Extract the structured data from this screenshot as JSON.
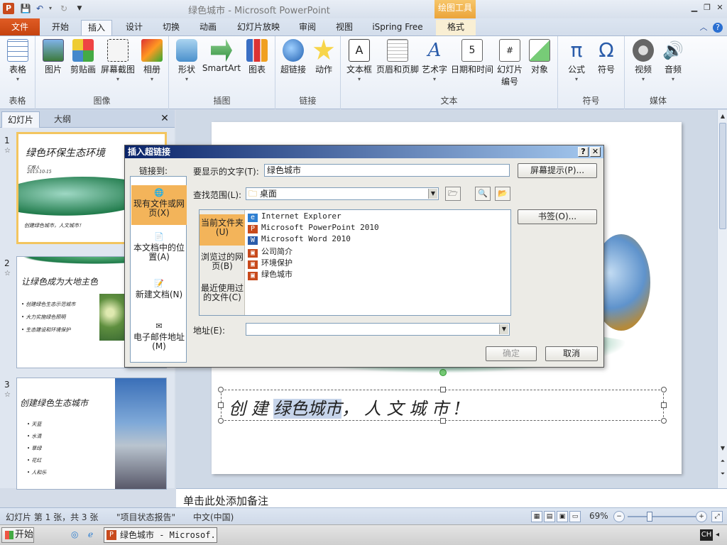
{
  "window": {
    "title": "绿色城市 - Microsoft PowerPoint",
    "app_icon": "P",
    "contextual_tab": "绘图工具"
  },
  "icons": [
    "powerpoint-app-icon",
    "save-icon",
    "undo-icon",
    "redo-icon",
    "minimize-icon",
    "restore-icon",
    "close-icon",
    "help-icon"
  ],
  "tabs": [
    {
      "label": "文件"
    },
    {
      "label": "开始"
    },
    {
      "label": "插入"
    },
    {
      "label": "设计"
    },
    {
      "label": "切换"
    },
    {
      "label": "动画"
    },
    {
      "label": "幻灯片放映"
    },
    {
      "label": "审阅"
    },
    {
      "label": "视图"
    },
    {
      "label": "iSpring Free"
    },
    {
      "label": "格式"
    }
  ],
  "ribbon": {
    "groups": [
      {
        "label": "表格",
        "buttons": [
          "表格"
        ]
      },
      {
        "label": "图像",
        "buttons": [
          "图片",
          "剪贴画",
          "屏幕截图",
          "相册"
        ]
      },
      {
        "label": "插图",
        "buttons": [
          "形状",
          "SmartArt",
          "图表"
        ]
      },
      {
        "label": "链接",
        "buttons": [
          "超链接",
          "动作"
        ]
      },
      {
        "label": "文本",
        "buttons": [
          "文本框",
          "页眉和页脚",
          "艺术字",
          "日期和时间",
          "幻灯片",
          "对象"
        ],
        "number_label": "编号"
      },
      {
        "label": "符号",
        "buttons": [
          "公式",
          "符号"
        ]
      },
      {
        "label": "媒体",
        "buttons": [
          "视频",
          "音频"
        ]
      }
    ]
  },
  "left_pane": {
    "tabs": [
      "幻灯片",
      "大纲"
    ],
    "close": "✕",
    "slides": [
      {
        "num": "1",
        "title": "绿色环保生态环境",
        "sub1": "汇报人",
        "sub2": "2013-10-15",
        "footer": "创建绿色城市，人文城市！"
      },
      {
        "num": "2",
        "title": "让绿色成为大地主色",
        "bullets": [
          "创建绿色生态示范城市",
          "大力实施绿色照明",
          "生态建设和环境保护"
        ]
      },
      {
        "num": "3",
        "title": "创建绿色生态城市",
        "bullets": [
          "天蓝",
          "水清",
          "草绿",
          "花红",
          "人和乐"
        ]
      }
    ]
  },
  "slide": {
    "text_plain1": "创 建 ",
    "text_selected": "绿色城市",
    "text_plain2": "， 人 文 城 市 !"
  },
  "notes_placeholder": "单击此处添加备注",
  "status": {
    "slide_info": "幻灯片 第 1 张，共 3 张",
    "theme": "\"项目状态报告\"",
    "language": "中文(中国)",
    "zoom": "69%",
    "zoom_level_percent": 69
  },
  "taskbar": {
    "start": "开始",
    "item": "绿色城市 - Microsof...",
    "ime": "CH"
  },
  "dialog": {
    "title": "插入超链接",
    "help_btn": "?",
    "close_btn": "✕",
    "link_to_label": "链接到:",
    "link_options": [
      "现有文件或网页(X)",
      "本文档中的位置(A)",
      "新建文档(N)",
      "电子邮件地址(M)"
    ],
    "display_text_label": "要显示的文字(T):",
    "display_text_value": "绿色城市",
    "screentip_btn": "屏幕提示(P)...",
    "look_in_label": "查找范围(L):",
    "look_in_value": "桌面",
    "bookmark_btn": "书签(O)...",
    "locations": [
      "当前文件夹(U)",
      "浏览过的网页(B)",
      "最近使用过的文件(C)"
    ],
    "files": [
      {
        "name": "Internet Explorer",
        "icon": "ie-icon",
        "color": "#2f7fd1"
      },
      {
        "name": "Microsoft PowerPoint 2010",
        "icon": "powerpoint-icon",
        "color": "#c84a1c"
      },
      {
        "name": "Microsoft Word 2010",
        "icon": "word-icon",
        "color": "#2a5caa"
      },
      {
        "name": "公司简介",
        "icon": "pptx-file-icon",
        "color": "#c84a1c"
      },
      {
        "name": "环境保护",
        "icon": "pptx-file-icon",
        "color": "#c84a1c"
      },
      {
        "name": "绿色城市",
        "icon": "pptx-file-icon",
        "color": "#c84a1c"
      }
    ],
    "address_label": "地址(E):",
    "address_value": "",
    "ok_btn": "确定",
    "cancel_btn": "取消"
  },
  "colors": {
    "file_tab": "#c5430f",
    "selection_orange": "#f3b45a",
    "dialog_title": "#0a246a",
    "slide_green": "#1f7a4a"
  }
}
